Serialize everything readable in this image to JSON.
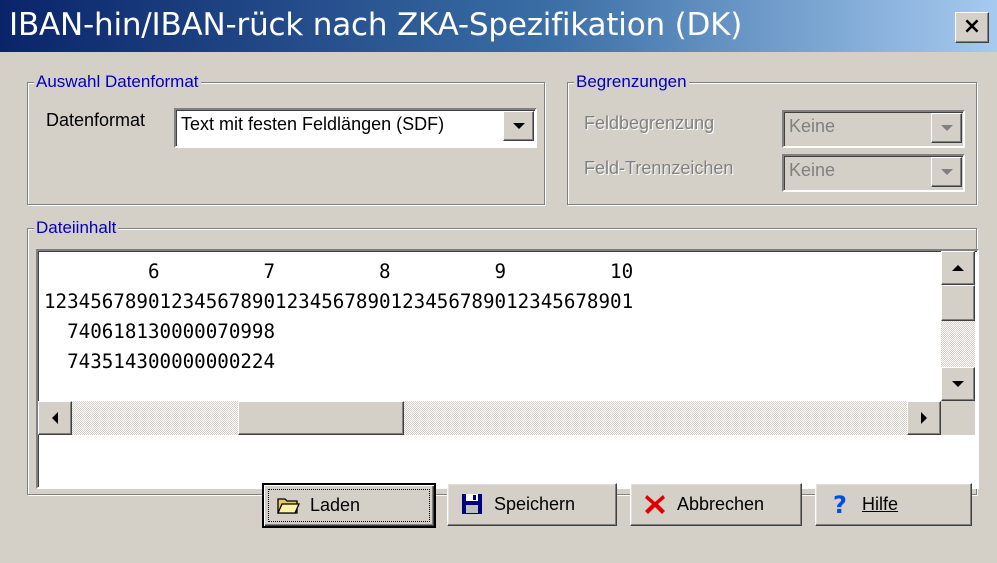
{
  "window": {
    "title": "IBAN-hin/IBAN-rück nach ZKA-Spezifikation (DK)",
    "close_label": "×"
  },
  "auswahl": {
    "legend": "Auswahl Datenformat",
    "datenformat_label": "Datenformat",
    "datenformat_value": "Text mit festen Feldlängen (SDF)"
  },
  "begrenzungen": {
    "legend": "Begrenzungen",
    "feldbegrenzung_label": "Feldbegrenzung",
    "feldbegrenzung_value": "Keine",
    "trennzeichen_label": "Feld-Trennzeichen",
    "trennzeichen_value": "Keine"
  },
  "dateiinhalt": {
    "legend": "Dateiinhalt",
    "lines": [
      "         6         7         8         9         10",
      "123456789012345678901234567890123456789012345678901",
      "  740618130000070998",
      "  743514300000000224"
    ]
  },
  "buttons": {
    "laden": "Laden",
    "speichern": "Speichern",
    "abbrechen": "Abbrechen",
    "hilfe": "Hilfe"
  },
  "colors": {
    "face": "#d4d0c8",
    "title_start": "#0a246a",
    "title_end": "#a6caf0",
    "legend_text": "#0000b8"
  },
  "icons": {
    "laden": "open-folder-icon",
    "speichern": "floppy-disk-icon",
    "abbrechen": "red-x-icon",
    "hilfe": "question-mark-icon"
  }
}
